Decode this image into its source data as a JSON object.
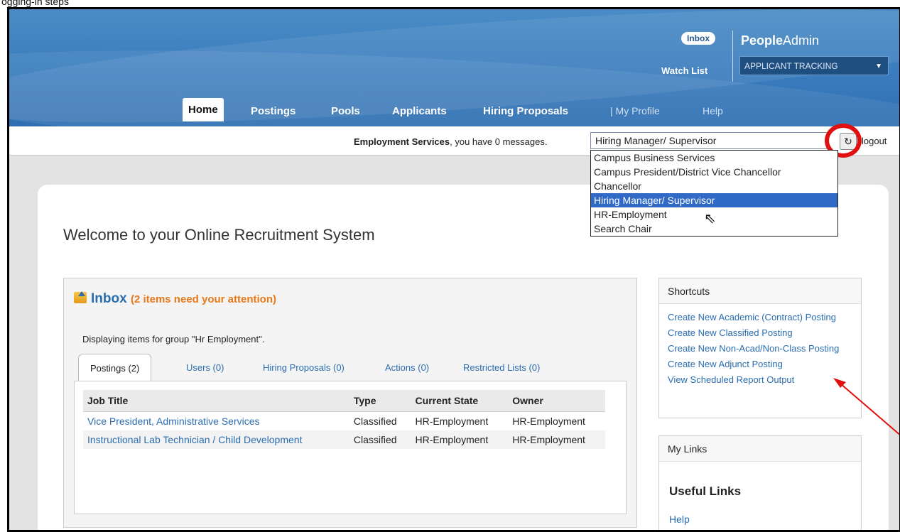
{
  "caption": "ogging-in steps",
  "header": {
    "inbox_label": "Inbox",
    "watch_list": "Watch List",
    "brand_bold": "People",
    "brand_light": "Admin",
    "app_selector": "APPLICANT TRACKING"
  },
  "nav": {
    "home": "Home",
    "postings": "Postings",
    "pools": "Pools",
    "applicants": "Applicants",
    "hiring_proposals": "Hiring Proposals",
    "my_profile": "| My Profile",
    "help": "Help"
  },
  "messagebar": {
    "user": "Employment Services",
    "message": ", you have 0 messages.",
    "role_selected": "Hiring Manager/ Supervisor",
    "refresh_icon": "refresh-icon",
    "logout": "logout"
  },
  "role_options": [
    "Campus Business Services",
    "Campus President/District Vice Chancellor",
    "Chancellor",
    "Hiring Manager/ Supervisor",
    "HR-Employment",
    "Search Chair"
  ],
  "main": {
    "welcome": "Welcome to your Online Recruitment System"
  },
  "inbox": {
    "title": "Inbox",
    "attention": "(2 items need your attention)",
    "displaying": "Displaying items for group \"Hr Employment\".",
    "tabs": [
      "Postings (2)",
      "Users (0)",
      "Hiring Proposals (0)",
      "Actions (0)",
      "Restricted Lists (0)"
    ],
    "columns": [
      "Job Title",
      "Type",
      "Current State",
      "Owner"
    ],
    "rows": [
      [
        "Vice President, Administrative Services",
        "Classified",
        "HR-Employment",
        "HR-Employment"
      ],
      [
        "Instructional Lab Technician / Child Development",
        "Classified",
        "HR-Employment",
        "HR-Employment"
      ]
    ]
  },
  "shortcuts": {
    "title": "Shortcuts",
    "links": [
      "Create New Academic (Contract) Posting",
      "Create New Classified Posting",
      "Create New Non-Acad/Non-Class Posting",
      "Create New Adjunct Posting",
      "View Scheduled Report Output"
    ]
  },
  "my_links": {
    "title": "My Links",
    "useful_links": "Useful Links",
    "help": "Help"
  },
  "colors": {
    "header_blue": "#3a7cbd",
    "link_blue": "#2a6db0",
    "attention_orange": "#e6791a",
    "annotation_red": "#e01010",
    "selected_option": "#3169c6"
  }
}
